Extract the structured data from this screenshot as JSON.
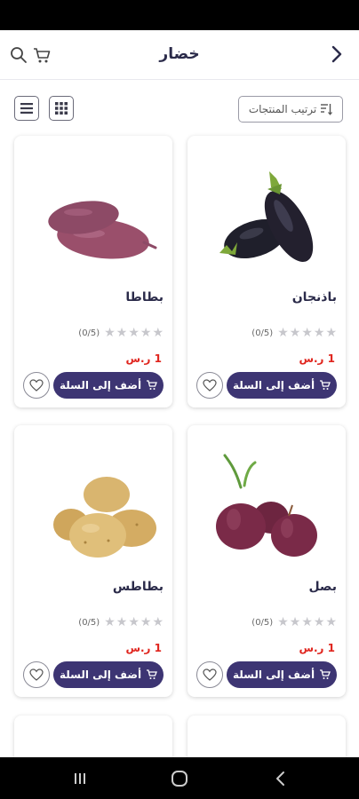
{
  "header": {
    "title": "خضار",
    "icons": [
      "search-icon",
      "cart-icon",
      "chevron-right-icon"
    ]
  },
  "toolbar": {
    "sort_label": "ترتيب المنتجات",
    "icons": [
      "list-view-icon",
      "grid-view-icon",
      "sort-icon"
    ]
  },
  "products": [
    {
      "name": "باذنجان",
      "rating": 0,
      "rating_label": "(0/5)",
      "price": "1 ر.س",
      "add_label": "أضف إلى السلة",
      "image": "eggplant"
    },
    {
      "name": "بطاطا",
      "rating": 0,
      "rating_label": "(0/5)",
      "price": "1 ر.س",
      "add_label": "أضف إلى السلة",
      "image": "sweet-potato"
    },
    {
      "name": "بصل",
      "rating": 0,
      "rating_label": "(0/5)",
      "price": "1 ر.س",
      "add_label": "أضف إلى السلة",
      "image": "red-onion"
    },
    {
      "name": "بطاطس",
      "rating": 0,
      "rating_label": "(0/5)",
      "price": "1 ر.س",
      "add_label": "أضف إلى السلة",
      "image": "potato"
    }
  ],
  "colors": {
    "accent": "#3d3573",
    "price": "#e0261f",
    "title": "#2b2b4a",
    "star_empty": "#c7c7cc"
  },
  "nav": {
    "icons": [
      "recent-apps-icon",
      "home-icon",
      "back-icon"
    ]
  }
}
